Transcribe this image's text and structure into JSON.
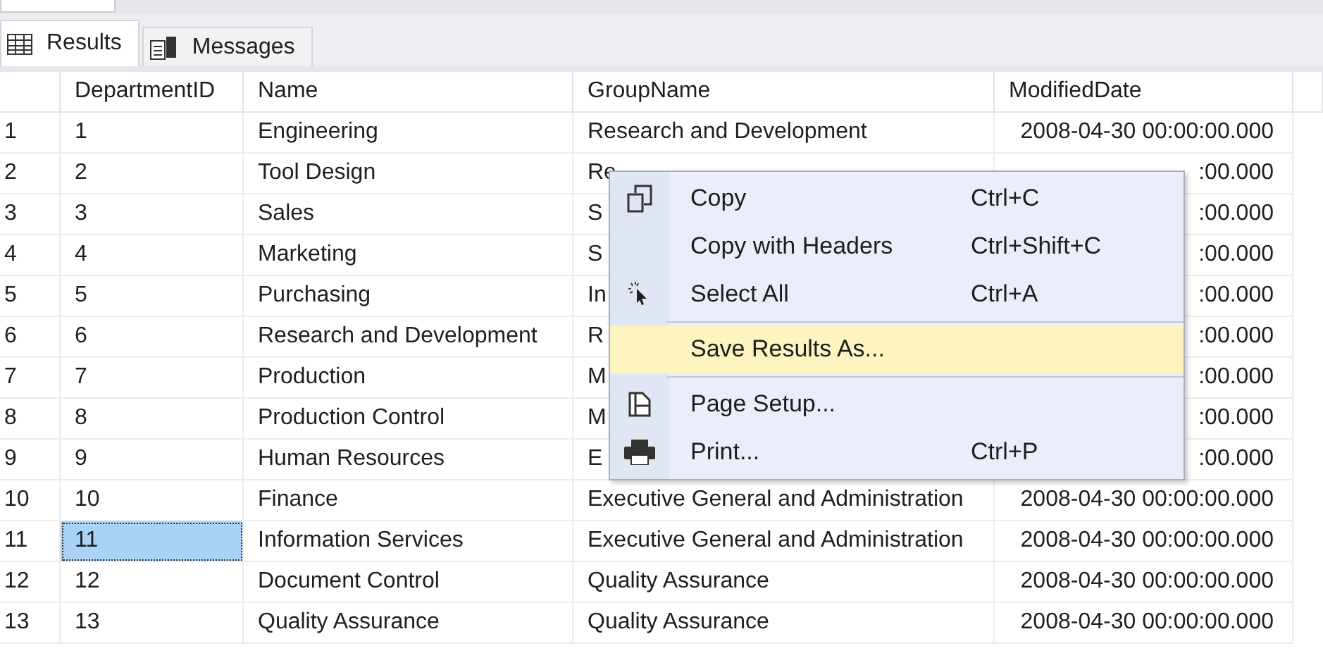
{
  "tabs": [
    {
      "label": "Results",
      "selected": true
    },
    {
      "label": "Messages",
      "selected": false
    }
  ],
  "table": {
    "columns": [
      "DepartmentID",
      "Name",
      "GroupName",
      "ModifiedDate"
    ],
    "rows": [
      {
        "number": "1",
        "cells": [
          "1",
          "Engineering",
          "Research and Development",
          "2008-04-30 00:00:00.000"
        ],
        "selected": false
      },
      {
        "number": "2",
        "cells": [
          "2",
          "Tool Design",
          "Re",
          ":00.000"
        ],
        "selected": false
      },
      {
        "number": "3",
        "cells": [
          "3",
          "Sales",
          "S",
          ":00.000"
        ],
        "selected": false
      },
      {
        "number": "4",
        "cells": [
          "4",
          "Marketing",
          "S",
          ":00.000"
        ],
        "selected": false
      },
      {
        "number": "5",
        "cells": [
          "5",
          "Purchasing",
          "In",
          ":00.000"
        ],
        "selected": false
      },
      {
        "number": "6",
        "cells": [
          "6",
          "Research and Development",
          "R",
          ":00.000"
        ],
        "selected": false
      },
      {
        "number": "7",
        "cells": [
          "7",
          "Production",
          "M",
          ":00.000"
        ],
        "selected": false
      },
      {
        "number": "8",
        "cells": [
          "8",
          "Production Control",
          "M",
          ":00.000"
        ],
        "selected": false
      },
      {
        "number": "9",
        "cells": [
          "9",
          "Human Resources",
          "E",
          ":00.000"
        ],
        "selected": false
      },
      {
        "number": "10",
        "cells": [
          "10",
          "Finance",
          "Executive General and Administration",
          "2008-04-30 00:00:00.000"
        ],
        "selected": false
      },
      {
        "number": "11",
        "cells": [
          "11",
          "Information Services",
          "Executive General and Administration",
          "2008-04-30 00:00:00.000"
        ],
        "selected": true
      },
      {
        "number": "12",
        "cells": [
          "12",
          "Document Control",
          "Quality Assurance",
          "2008-04-30 00:00:00.000"
        ],
        "selected": false
      },
      {
        "number": "13",
        "cells": [
          "13",
          "Quality Assurance",
          "Quality Assurance",
          "2008-04-30 00:00:00.000"
        ],
        "selected": false
      }
    ]
  },
  "context_menu": {
    "items": [
      {
        "kind": "item",
        "label": "Copy",
        "shortcut": "Ctrl+C",
        "selected": false
      },
      {
        "kind": "item",
        "label": "Copy with Headers",
        "shortcut": "Ctrl+Shift+C",
        "selected": false
      },
      {
        "kind": "item",
        "label": "Select All",
        "shortcut": "Ctrl+A",
        "selected": false
      },
      {
        "kind": "separator"
      },
      {
        "kind": "item",
        "label": "Save Results As...",
        "selected": true
      },
      {
        "kind": "separator"
      },
      {
        "kind": "item",
        "label": "Page Setup...",
        "selected": false
      },
      {
        "kind": "item",
        "label": "Print...",
        "shortcut": "Ctrl+P",
        "selected": false
      }
    ]
  }
}
